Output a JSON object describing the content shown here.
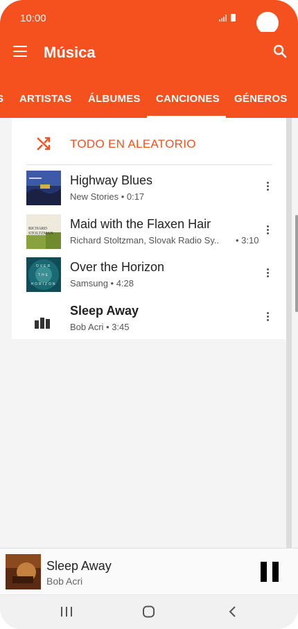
{
  "status_bar": {
    "time": "10:00"
  },
  "app_bar": {
    "title": "Música"
  },
  "tabs": [
    {
      "label": "S"
    },
    {
      "label": "ARTISTAS"
    },
    {
      "label": "ÁLBUMES"
    },
    {
      "label": "CANCIONES",
      "selected": true
    },
    {
      "label": "GÉNEROS"
    }
  ],
  "shuffle": {
    "label": "TODO EN ALEATORIO"
  },
  "songs": [
    {
      "title": "Highway Blues",
      "subtitle": "New Stories • 0:17",
      "duration": ""
    },
    {
      "title": "Maid with the Flaxen Hair",
      "subtitle": "Richard Stoltzman, Slovak Radio Sy..",
      "duration": "• 3:10"
    },
    {
      "title": "Over the Horizon",
      "subtitle": "Samsung • 4:28",
      "duration": ""
    },
    {
      "title": "Sleep Away",
      "subtitle": "Bob Acri • 3:45",
      "duration": "",
      "now_playing": true
    }
  ],
  "album_text": {
    "maid_top": "RICHARD",
    "maid_bottom": "STOLTZMAN",
    "horizon_lines": [
      "OVER",
      "THE",
      "HORIZON"
    ]
  },
  "player": {
    "title": "Sleep Away",
    "artist": "Bob Acri"
  },
  "icons": {
    "menu": "hamburger-icon",
    "search": "search-icon",
    "shuffle": "shuffle-icon",
    "more": "more-vertical-icon",
    "equalizer": "equalizer-icon",
    "pause": "pause-icon",
    "recents": "recents-icon",
    "home": "home-icon",
    "back": "back-icon"
  },
  "colors": {
    "accent": "#f4511e",
    "background": "#f4f4f4"
  }
}
